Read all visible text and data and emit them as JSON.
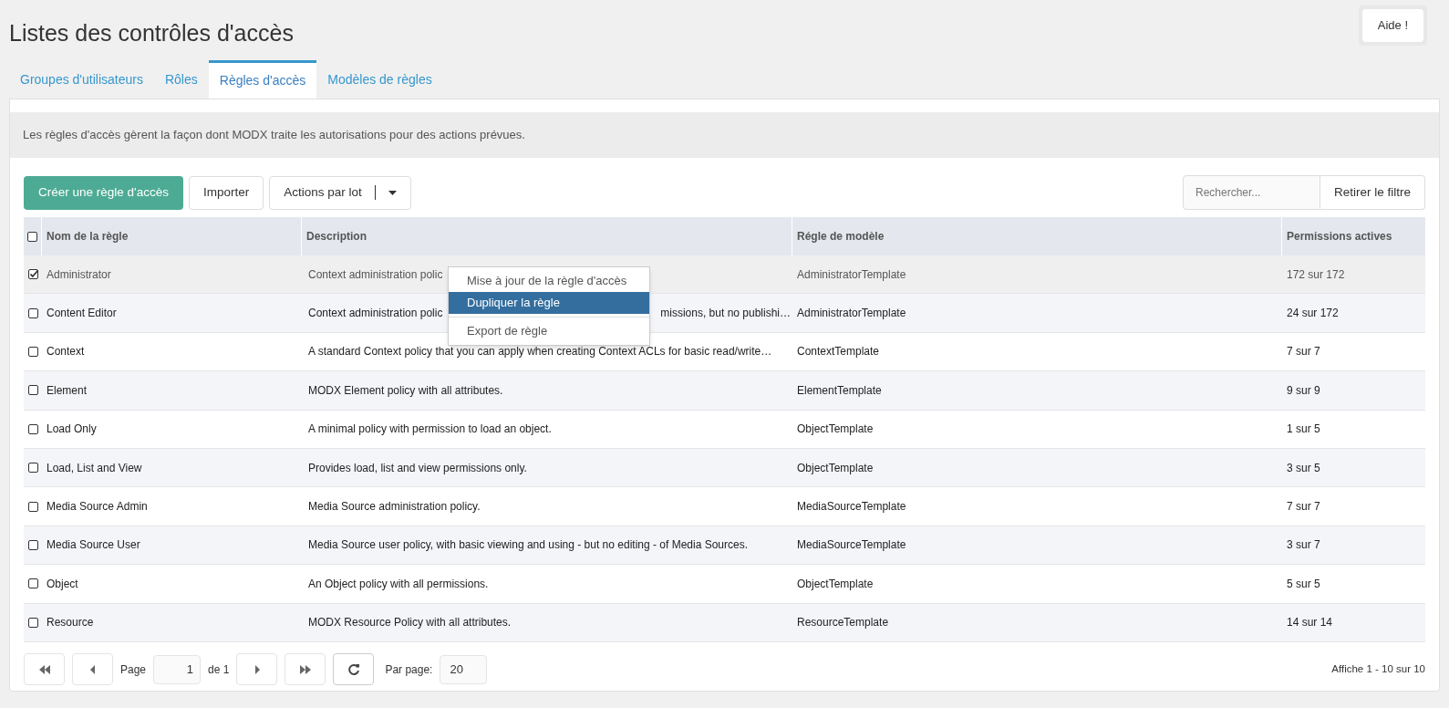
{
  "title": "Listes des contrôles d'accès",
  "help_button": "Aide !",
  "tabs": [
    {
      "label": "Groupes d'utilisateurs",
      "selected": false
    },
    {
      "label": "Rôles",
      "selected": false
    },
    {
      "label": "Règles d'accès",
      "selected": true
    },
    {
      "label": "Modèles de règles",
      "selected": false
    }
  ],
  "intro": "Les règles d'accès gèrent la façon dont MODX traite les autorisations pour des actions prévues.",
  "toolbar": {
    "create_button": "Créer une règle d'accès",
    "import_button": "Importer",
    "bulk_button": "Actions par lot",
    "search": {
      "placeholder": "Rechercher..."
    },
    "clear_filter_button": "Retirer le filtre"
  },
  "table": {
    "header_checked": false,
    "columns": [
      "Nom de la règle",
      "Description",
      "Régle de modèle",
      "Permissions actives"
    ],
    "rows": [
      {
        "checked": true,
        "selected": true,
        "name": "Administrator",
        "description": [
          "Context administration polic"
        ],
        "template": "AdministratorTemplate",
        "permissions": "172 sur 172"
      },
      {
        "checked": false,
        "selected": false,
        "name": "Content Editor",
        "description": [
          "Context administration polic",
          "missions, but no publishi…"
        ],
        "template": "AdministratorTemplate",
        "permissions": "24 sur 172"
      },
      {
        "checked": false,
        "selected": false,
        "name": "Context",
        "description": [
          "A standard Context policy that you can apply when creating Context ACLs for basic read/write…"
        ],
        "template": "ContextTemplate",
        "permissions": "7 sur 7"
      },
      {
        "checked": false,
        "selected": false,
        "name": "Element",
        "description": [
          "MODX Element policy with all attributes."
        ],
        "template": "ElementTemplate",
        "permissions": "9 sur 9"
      },
      {
        "checked": false,
        "selected": false,
        "name": "Load Only",
        "description": [
          "A minimal policy with permission to load an object."
        ],
        "template": "ObjectTemplate",
        "permissions": "1 sur 5"
      },
      {
        "checked": false,
        "selected": false,
        "name": "Load, List and View",
        "description": [
          "Provides load, list and view permissions only."
        ],
        "template": "ObjectTemplate",
        "permissions": "3 sur 5"
      },
      {
        "checked": false,
        "selected": false,
        "name": "Media Source Admin",
        "description": [
          "Media Source administration policy."
        ],
        "template": "MediaSourceTemplate",
        "permissions": "7 sur 7"
      },
      {
        "checked": false,
        "selected": false,
        "name": "Media Source User",
        "description": [
          "Media Source user policy, with basic viewing and using - but no editing - of Media Sources."
        ],
        "template": "MediaSourceTemplate",
        "permissions": "3 sur 7"
      },
      {
        "checked": false,
        "selected": false,
        "name": "Object",
        "description": [
          "An Object policy with all permissions."
        ],
        "template": "ObjectTemplate",
        "permissions": "5 sur 5"
      },
      {
        "checked": false,
        "selected": false,
        "name": "Resource",
        "description": [
          "MODX Resource Policy with all attributes."
        ],
        "template": "ResourceTemplate",
        "permissions": "14 sur 14"
      }
    ]
  },
  "context_menu": [
    {
      "label": "Mise à jour de la règle d'accès",
      "selected": false
    },
    {
      "label": "Dupliquer la règle",
      "selected": true
    },
    {
      "label": "Export de règle",
      "selected": false
    }
  ],
  "pagination": {
    "page_label": "Page",
    "page": "1",
    "of_label": "de 1",
    "per_page_label": "Par page:",
    "per_page": "20",
    "summary": "Affiche 1 - 10 sur 10"
  }
}
